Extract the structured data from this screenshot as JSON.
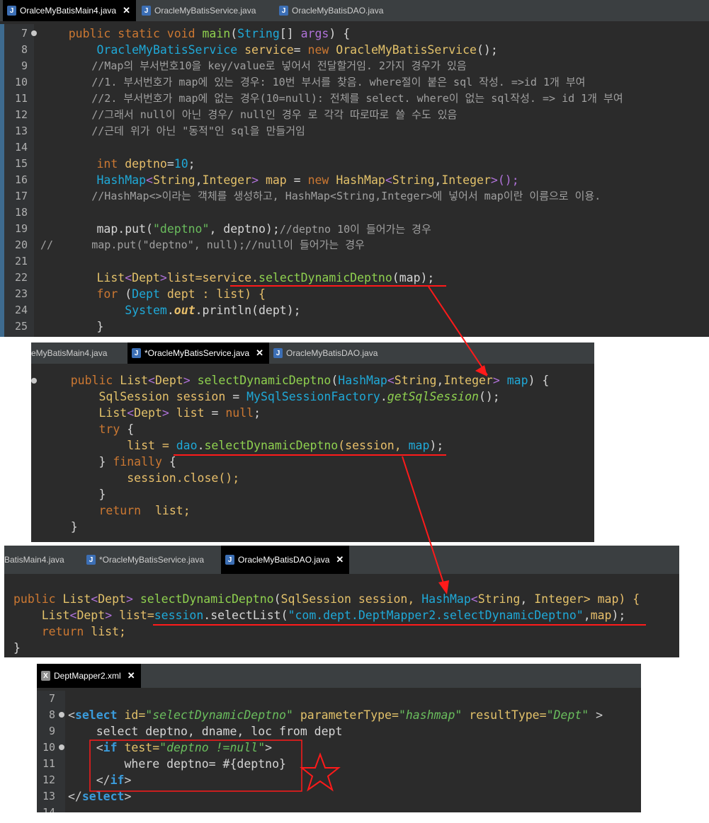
{
  "panel1": {
    "tabs": [
      {
        "label": "OralceMyBatisMain4.java",
        "active": true
      },
      {
        "label": "OracleMyBatisService.java",
        "active": false
      },
      {
        "label": "OracleMyBatisDAO.java",
        "active": false
      }
    ],
    "line_numbers": [
      "7",
      "8",
      "9",
      "10",
      "11",
      "12",
      "13",
      "14",
      "15",
      "16",
      "17",
      "18",
      "19",
      "20",
      "21",
      "22",
      "23",
      "24",
      "25"
    ],
    "l7": {
      "a": "    public static void ",
      "b": "main",
      "c": "(",
      "d": "String",
      "e": "[] ",
      "f": "args",
      "g": ") {"
    },
    "l8": {
      "a": "        ",
      "b": "OracleMyBatisService",
      "c": " service",
      "d": "= ",
      "e": "new",
      "f": " ",
      "g": "OracleMyBatisService",
      "h": "();"
    },
    "l9": "        //Map의 부서번호10을 key/value로 넣어서 전달할거임. 2가지 경우가 있음",
    "l10": "        //1. 부서번호가 map에 있는 경우: 10번 부서를 찾음. where절이 붙은 sql 작성. =>id 1개 부여",
    "l11": "        //2. 부서번호가 map에 없는 경우(10=null): 전체를 select. where이 없는 sql작성. => id 1개 부여",
    "l12": "        //그래서 null이 아닌 경우/ null인 경우 로 각각 따로따로 쓸 수도 있음",
    "l13": "        //근데 위가 아닌 \"동적\"인 sql을 만들거임",
    "l15": {
      "a": "        ",
      "b": "int",
      "c": " deptno",
      "d": "=",
      "e": "10",
      "f": ";"
    },
    "l16": {
      "a": "        ",
      "b": "HashMap",
      "c": "<",
      "d": "String",
      "e": ",",
      "f": "Integer",
      "g": "> ",
      "h": "map",
      "i": " = ",
      "j": "new",
      "k": " ",
      "l": "HashMap",
      "m": "<",
      "n": "String",
      "o": ",",
      "p": "Integer",
      "q": ">();"
    },
    "l17": "        //HashMap<>이라는 객체를 생성하고, HashMap<String,Integer>에 넣어서 map이란 이름으로 이용.",
    "l19": {
      "a": "        map.put(",
      "b": "\"deptno\"",
      "c": ", deptno);",
      "d": "//deptno 10이 들어가는 경우"
    },
    "l20": "//      map.put(\"deptno\", null);//null이 들어가는 경우",
    "l22": {
      "a": "        ",
      "b": "List",
      "c": "<",
      "d": "Dept",
      "e": ">",
      "f": "list",
      "g": "=service.",
      "h": "selectDynamicDeptno",
      "i": "(map);"
    },
    "l23": {
      "a": "        ",
      "b": "for",
      "c": " (",
      "d": "Dept",
      "e": " dept : list) {"
    },
    "l24": {
      "a": "            ",
      "b": "System",
      "c": ".",
      "d": "out",
      "e": ".println(dept);"
    },
    "l25": "        }"
  },
  "panel2": {
    "tabs": [
      {
        "label": "eMyBatisMain4.java",
        "active": false
      },
      {
        "label": "*OracleMyBatisService.java",
        "active": true
      },
      {
        "label": "OracleMyBatisDAO.java",
        "active": false
      }
    ],
    "l1": {
      "a": "    ",
      "b": "public",
      "c": " ",
      "d": "List",
      "e": "<",
      "f": "Dept",
      "g": "> ",
      "h": "selectDynamicDeptno",
      "i": "(",
      "j": "HashMap",
      "k": "<",
      "l": "String",
      "m": ",",
      "n": "Integer",
      "o": "> ",
      "p": "map",
      "q": ") {"
    },
    "l2": {
      "a": "        ",
      "b": "SqlSession",
      "c": " session ",
      "d": "= ",
      "e": "MySqlSessionFactory",
      "f": ".",
      "g": "getSqlSession",
      "h": "();"
    },
    "l3": {
      "a": "        ",
      "b": "List",
      "c": "<",
      "d": "Dept",
      "e": "> ",
      "f": "list",
      "g": " = ",
      "h": "null",
      "i": ";"
    },
    "l4": {
      "a": "        ",
      "b": "try",
      "c": " {"
    },
    "l5": {
      "a": "            list = ",
      "b": "dao",
      "c": ".",
      "d": "selectDynamicDeptno",
      "e": "(session, ",
      "f": "map",
      "g": ");"
    },
    "l6": {
      "a": "        } ",
      "b": "finally",
      "c": " {"
    },
    "l7": "            session.close();",
    "l8": "        }",
    "l9": {
      "a": "        ",
      "b": "return",
      "c": "  list;"
    },
    "l10": "    }"
  },
  "panel3": {
    "tabs": [
      {
        "label": "BatisMain4.java",
        "active": false
      },
      {
        "label": "*OracleMyBatisService.java",
        "active": false
      },
      {
        "label": "OracleMyBatisDAO.java",
        "active": true
      }
    ],
    "l1": {
      "a": "public",
      "b": " ",
      "c": "List",
      "d": "<",
      "e": "Dept",
      "f": "> ",
      "g": "selectDynamicDeptno",
      "h": "(",
      "i": "SqlSession",
      "j": " session, ",
      "k": "HashMap",
      "l": "<",
      "m": "String",
      "n": ", ",
      "o": "Integer",
      "p": "> map) {"
    },
    "l2": {
      "a": "    ",
      "b": "List",
      "c": "<",
      "d": "Dept",
      "e": "> ",
      "f": "list",
      "g": "=",
      "h": "session",
      "i": ".selectList(",
      "j": "\"com.dept.DeptMapper2.selectDynamicDeptno\"",
      "k": ",",
      "l": "map",
      "m": ");"
    },
    "l3": {
      "a": "    ",
      "b": "return",
      "c": " list;"
    },
    "l4": "}"
  },
  "panel4": {
    "tabs": [
      {
        "label": "DeptMapper2.xml",
        "active": true
      }
    ],
    "line_numbers": [
      "7",
      "8",
      "9",
      "10",
      "11",
      "12",
      "13",
      "14"
    ],
    "l8": {
      "a": "<",
      "b": "select",
      "c": " id=",
      "d": "\"selectDynamicDeptno\"",
      "e": " parameterType=",
      "f": "\"hashmap\"",
      "g": " resultType=",
      "h": "\"Dept\"",
      "i": " >"
    },
    "l9": "    select deptno, dname, loc from dept",
    "l10": {
      "a": "    <",
      "b": "if",
      "c": " test=",
      "d": "\"deptno !=null\"",
      "e": ">"
    },
    "l11": "        where deptno= #{deptno}",
    "l12": {
      "a": "    </",
      "b": "if",
      "c": ">"
    },
    "l13": {
      "a": "</",
      "b": "select",
      "c": ">"
    }
  },
  "colors": {
    "annotation": "#ff1a1a",
    "bg": "#2b2b2b",
    "keyword": "#cc7832",
    "type": "#1fa9d8"
  }
}
